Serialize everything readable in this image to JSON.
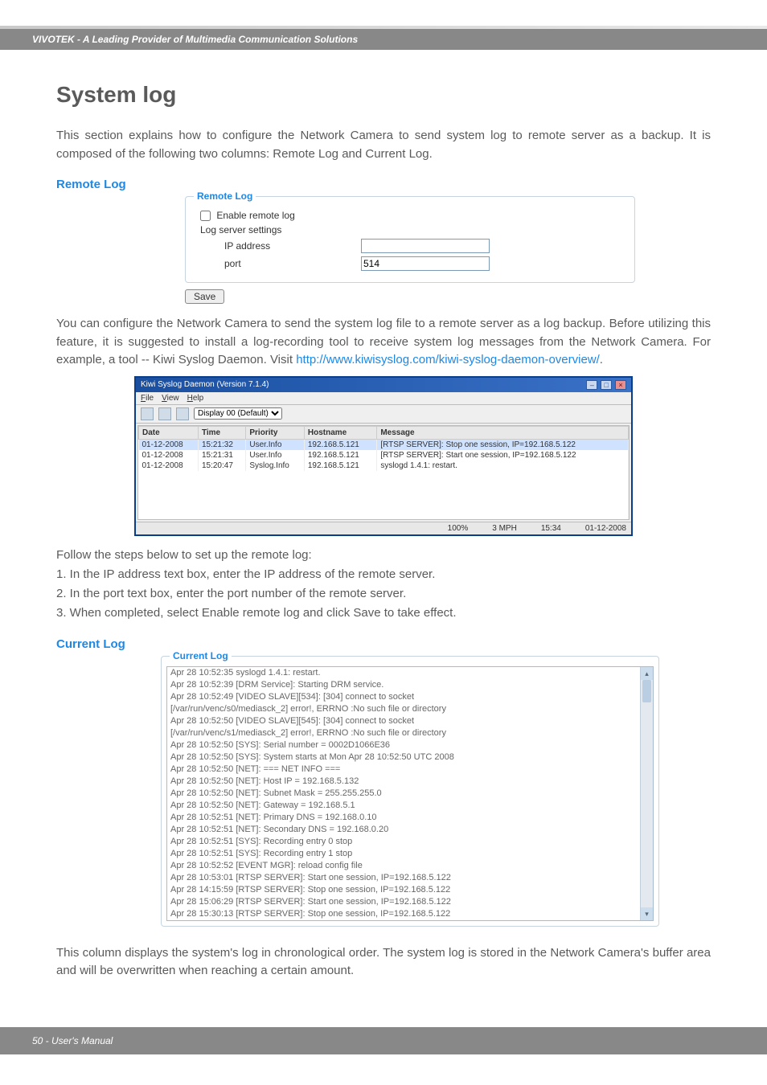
{
  "header": {
    "brand": "VIVOTEK - A Leading Provider of Multimedia Communication Solutions"
  },
  "page": {
    "title": "System log",
    "intro": "This section explains how to configure the Network Camera to send system log to remote server as a backup. It is composed of the following two columns: Remote Log and Current Log."
  },
  "remote": {
    "heading": "Remote Log",
    "panel_title": "Remote Log",
    "enable_label": "Enable remote log",
    "settings_label": "Log server settings",
    "ip_label": "IP address",
    "ip_value": "",
    "port_label": "port",
    "port_value": "514",
    "save_label": "Save",
    "body": "You can configure the Network Camera to send the system log file to a remote server as a log backup. Before utilizing this feature, it is suggested to install a log-recording tool to receive system log messages from the Network Camera. For example, a tool -- Kiwi Syslog Daemon. Visit ",
    "link_text": "http://www.kiwisyslog.com/kiwi-syslog-daemon-overview/",
    "link_suffix": "."
  },
  "kiwi": {
    "title": "Kiwi Syslog Daemon (Version 7.1.4)",
    "menu": [
      "File",
      "View",
      "Help"
    ],
    "display_label": "Display 00 (Default)",
    "columns": [
      "Date",
      "Time",
      "Priority",
      "Hostname",
      "Message"
    ],
    "rows": [
      {
        "date": "01-12-2008",
        "time": "15:21:32",
        "priority": "User.Info",
        "host": "192.168.5.121",
        "msg": "[RTSP SERVER]: Stop one session, IP=192.168.5.122"
      },
      {
        "date": "01-12-2008",
        "time": "15:21:31",
        "priority": "User.Info",
        "host": "192.168.5.121",
        "msg": "[RTSP SERVER]: Start one session, IP=192.168.5.122"
      },
      {
        "date": "01-12-2008",
        "time": "15:20:47",
        "priority": "Syslog.Info",
        "host": "192.168.5.121",
        "msg": "syslogd 1.4.1: restart."
      }
    ],
    "status_pct": "100%",
    "status_rate": "3 MPH",
    "status_time": "15:34",
    "status_date": "01-12-2008"
  },
  "steps": {
    "lead": "Follow the steps below to set up the remote log:",
    "s1": "1. In the IP address text box, enter the IP address of the remote server.",
    "s2": "2. In the port text box, enter the port number of the remote server.",
    "s3": "3. When completed, select Enable remote log and click Save to take effect."
  },
  "current": {
    "heading": "Current Log",
    "panel_title": "Current Log",
    "lines": [
      "Apr 28 10:52:35 syslogd 1.4.1: restart.",
      "Apr 28 10:52:39 [DRM Service]: Starting DRM service.",
      "Apr 28 10:52:49 [VIDEO SLAVE][534]: [304] connect to socket",
      "[/var/run/venc/s0/mediasck_2] error!, ERRNO :No such file or directory",
      "Apr 28 10:52:50 [VIDEO SLAVE][545]: [304] connect to socket",
      "[/var/run/venc/s1/mediasck_2] error!, ERRNO :No such file or directory",
      "Apr 28 10:52:50 [SYS]: Serial number = 0002D1066E36",
      "Apr 28 10:52:50 [SYS]: System starts at Mon Apr 28 10:52:50 UTC 2008",
      "Apr 28 10:52:50 [NET]: === NET INFO ===",
      "Apr 28 10:52:50 [NET]: Host IP = 192.168.5.132",
      "Apr 28 10:52:50 [NET]: Subnet Mask = 255.255.255.0",
      "Apr 28 10:52:50 [NET]: Gateway = 192.168.5.1",
      "Apr 28 10:52:51 [NET]: Primary DNS = 192.168.0.10",
      "Apr 28 10:52:51 [NET]: Secondary DNS = 192.168.0.20",
      "Apr 28 10:52:51 [SYS]: Recording entry 0 stop",
      "Apr 28 10:52:51 [SYS]: Recording entry 1 stop",
      "Apr 28 10:52:52 [EVENT MGR]: reload config file",
      "Apr 28 10:53:01 [RTSP SERVER]: Start one session, IP=192.168.5.122",
      "Apr 28 14:15:59 [RTSP SERVER]: Stop one session, IP=192.168.5.122",
      "Apr 28 15:06:29 [RTSP SERVER]: Start one session, IP=192.168.5.122",
      "Apr 28 15:30:13 [RTSP SERVER]: Stop one session, IP=192.168.5.122"
    ],
    "body": "This column displays the system's log in chronological order. The system log is stored in the Network Camera's buffer area and will be overwritten when reaching a certain amount."
  },
  "footer": {
    "text": "50 - User's Manual"
  }
}
